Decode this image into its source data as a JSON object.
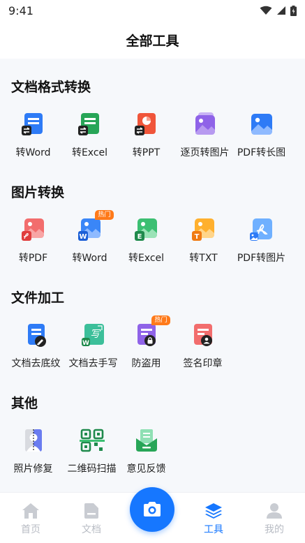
{
  "status_bar": {
    "time": "9:41"
  },
  "header": {
    "title": "全部工具"
  },
  "sections": {
    "doc_convert": {
      "title": "文档格式转换",
      "tools": [
        {
          "label": "转Word"
        },
        {
          "label": "转Excel"
        },
        {
          "label": "转PPT"
        },
        {
          "label": "逐页转图片"
        },
        {
          "label": "PDF转长图"
        }
      ]
    },
    "image_convert": {
      "title": "图片转换",
      "tools": [
        {
          "label": "转PDF"
        },
        {
          "label": "转Word",
          "badge": "热门"
        },
        {
          "label": "转Excel"
        },
        {
          "label": "转TXT"
        },
        {
          "label": "PDF转图片"
        }
      ]
    },
    "file_process": {
      "title": "文件加工",
      "tools": [
        {
          "label": "文档去底纹"
        },
        {
          "label": "文档去手写"
        },
        {
          "label": "防盗用",
          "badge": "热门"
        },
        {
          "label": "签名印章"
        }
      ]
    },
    "other": {
      "title": "其他",
      "tools": [
        {
          "label": "照片修复"
        },
        {
          "label": "二维码扫描"
        },
        {
          "label": "意见反馈"
        }
      ]
    }
  },
  "tab_bar": {
    "tabs": [
      {
        "label": "首页",
        "icon": "home-icon"
      },
      {
        "label": "文档",
        "icon": "document-icon"
      },
      {
        "label": "工具",
        "icon": "layers-icon",
        "active": true
      },
      {
        "label": "我的",
        "icon": "user-icon"
      }
    ],
    "camera_icon": "camera-icon"
  },
  "colors": {
    "accent": "#1677ff",
    "hot_badge": "#ff7a1a",
    "inactive": "#b8bcc4"
  }
}
